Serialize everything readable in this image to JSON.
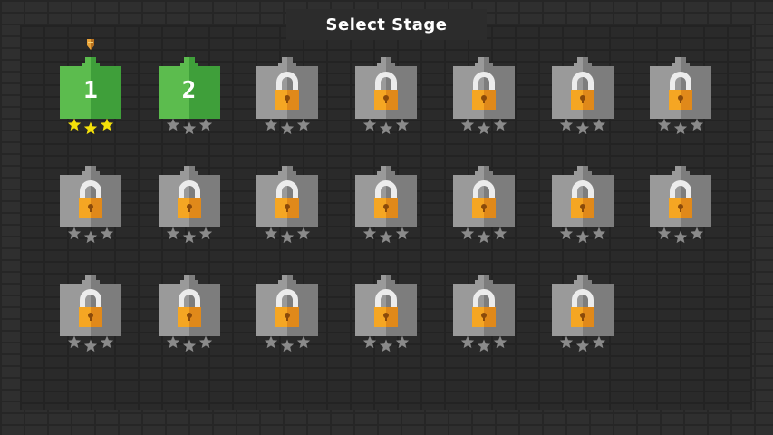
{
  "header": {
    "title": "Select Stage"
  },
  "colors": {
    "unlocked_light": "#5cbc4e",
    "unlocked_dark": "#3f9f3a",
    "locked_light": "#9a9a9a",
    "locked_dark": "#7d7d7d",
    "lock_body": "#f5a623",
    "lock_body_dark": "#e0891a",
    "lock_shackle": "#ececec",
    "star_earned": "#f4e00a",
    "star_empty": "#8a8a8a"
  },
  "stages": [
    {
      "label": "1",
      "locked": false,
      "stars": 3
    },
    {
      "label": "2",
      "locked": false,
      "stars": 0
    },
    {
      "label": "",
      "locked": true,
      "stars": 0
    },
    {
      "label": "",
      "locked": true,
      "stars": 0
    },
    {
      "label": "",
      "locked": true,
      "stars": 0
    },
    {
      "label": "",
      "locked": true,
      "stars": 0
    },
    {
      "label": "",
      "locked": true,
      "stars": 0
    },
    {
      "label": "",
      "locked": true,
      "stars": 0
    },
    {
      "label": "",
      "locked": true,
      "stars": 0
    },
    {
      "label": "",
      "locked": true,
      "stars": 0
    },
    {
      "label": "",
      "locked": true,
      "stars": 0
    },
    {
      "label": "",
      "locked": true,
      "stars": 0
    },
    {
      "label": "",
      "locked": true,
      "stars": 0
    },
    {
      "label": "",
      "locked": true,
      "stars": 0
    },
    {
      "label": "",
      "locked": true,
      "stars": 0
    },
    {
      "label": "",
      "locked": true,
      "stars": 0
    },
    {
      "label": "",
      "locked": true,
      "stars": 0
    },
    {
      "label": "",
      "locked": true,
      "stars": 0
    },
    {
      "label": "",
      "locked": true,
      "stars": 0
    },
    {
      "label": "",
      "locked": true,
      "stars": 0
    }
  ],
  "current_stage_marker": {
    "icon": "shield-marker-icon",
    "stage": "1"
  }
}
